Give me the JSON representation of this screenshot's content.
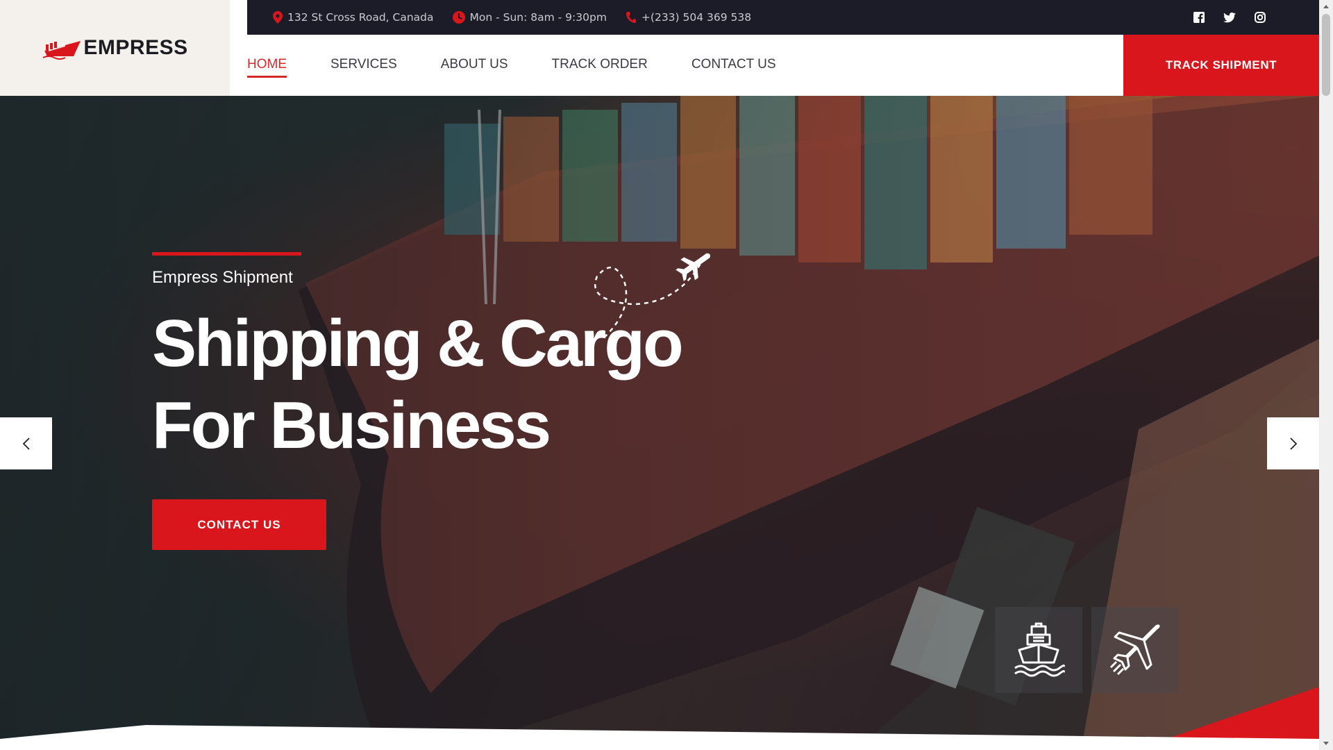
{
  "brand": {
    "name": "EMPRESS",
    "accent_color": "#d8161b",
    "dark_color": "#1c1c28"
  },
  "topbar": {
    "address": "132 St Cross Road, Canada",
    "hours": "Mon - Sun: 8am - 9:30pm",
    "phone": "+(233) 504 369 538",
    "icons": {
      "address": "map-pin-icon",
      "hours": "clock-icon",
      "phone": "phone-icon"
    },
    "socials": [
      "facebook-icon",
      "twitter-icon",
      "instagram-icon"
    ]
  },
  "nav": {
    "items": [
      {
        "label": "HOME",
        "active": true
      },
      {
        "label": "SERVICES",
        "active": false
      },
      {
        "label": "ABOUT US",
        "active": false
      },
      {
        "label": "TRACK ORDER",
        "active": false
      },
      {
        "label": "CONTACT US",
        "active": false
      }
    ],
    "cta_label": "TRACK SHIPMENT"
  },
  "hero": {
    "kicker": "Empress Shipment",
    "headline_line1": "Shipping & Cargo",
    "headline_line2": "For Business",
    "cta_label": "CONTACT US",
    "icons": {
      "prev": "chevron-left-icon",
      "next": "chevron-right-icon",
      "tile1": "ship-icon",
      "tile2": "airplane-icon"
    }
  }
}
